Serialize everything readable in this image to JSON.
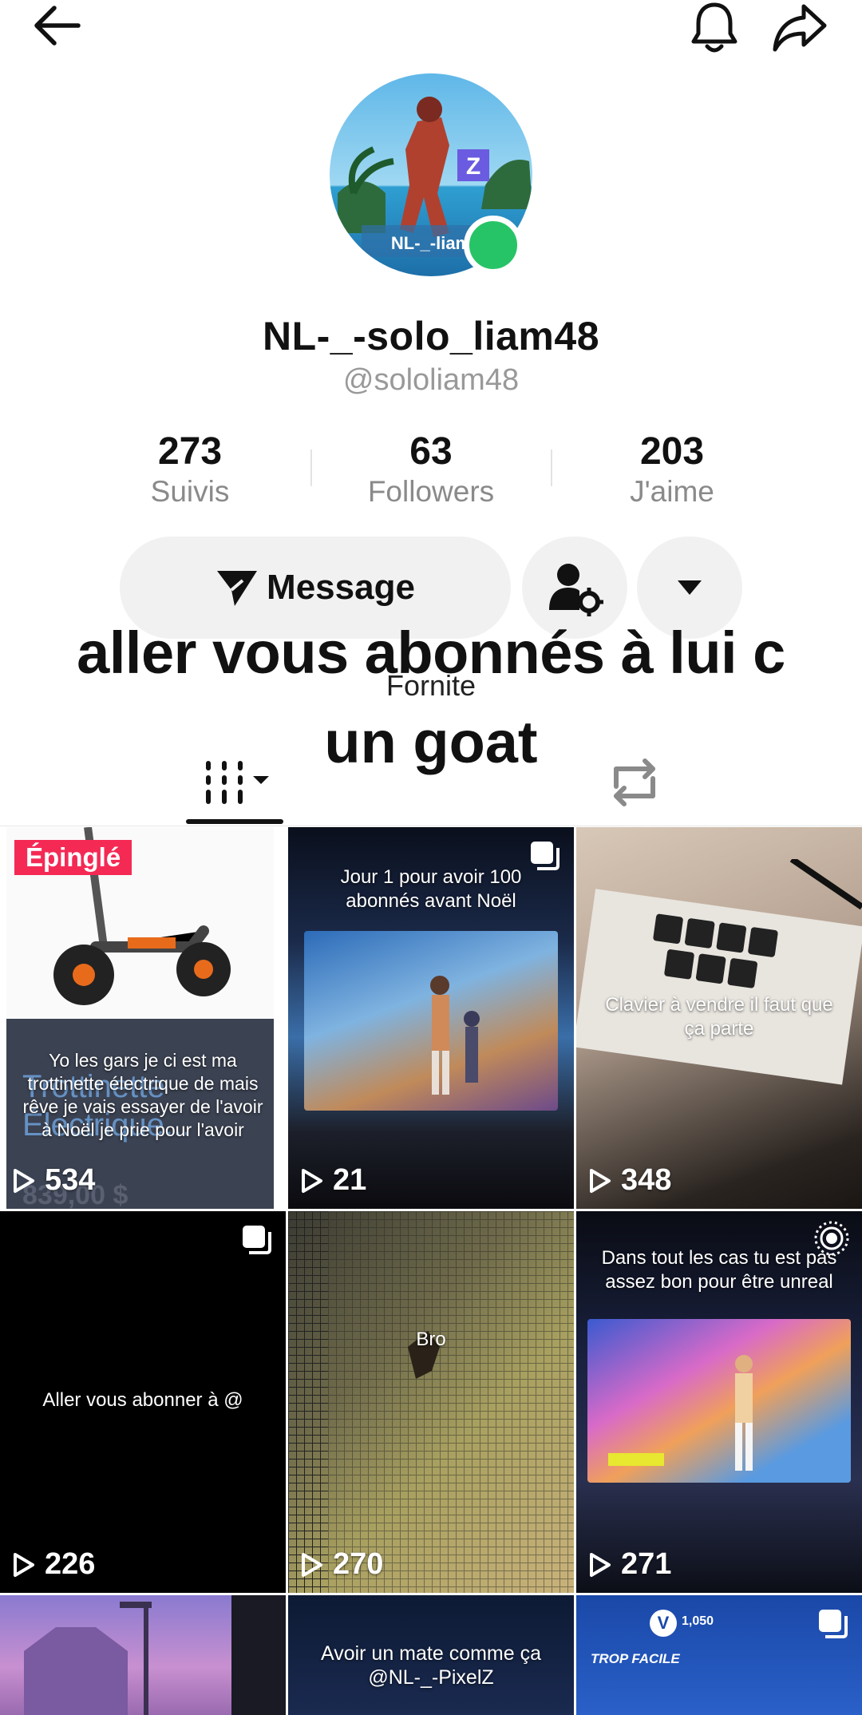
{
  "profile": {
    "display_name": "NL-_-solo_liam48",
    "handle": "@sololiam48",
    "avatar_text": "NL-_-liam"
  },
  "stats": [
    {
      "value": "273",
      "label": "Suivis"
    },
    {
      "value": "63",
      "label": "Followers"
    },
    {
      "value": "203",
      "label": "J'aime"
    }
  ],
  "actions": {
    "message_label": "Message"
  },
  "bio": {
    "line1": "aller vous abonnés à lui c",
    "small": "Fornite",
    "line2": "un goat"
  },
  "colors": {
    "accent_pink": "#f42a55",
    "online": "#27c467"
  },
  "videos": [
    {
      "views": "534",
      "pinned_label": "Épinglé",
      "caption": "Yo les gars je ci est ma trottinette électrique de mais rêve je vais essayer de l'avoir à Noël je prie pour l'avoir",
      "overlay_line1": "Trottinette",
      "overlay_line2": "Électrique...",
      "overlay_price": "839,00 $"
    },
    {
      "views": "21",
      "caption": "Jour 1 pour avoir 100 abonnés avant Noël"
    },
    {
      "views": "348",
      "caption": "Clavier à vendre il faut que ça parte"
    },
    {
      "views": "226",
      "caption": "Aller vous abonner à @"
    },
    {
      "views": "270",
      "caption": "Bro"
    },
    {
      "views": "271",
      "caption": "Dans tout les cas  tu est pas assez bon pour être unreal"
    },
    {
      "caption": ""
    },
    {
      "caption": "Avoir un mate comme ça @NL-_-PixelZ"
    },
    {
      "caption": "TROP FACILE",
      "vbucks": "1,050"
    }
  ]
}
